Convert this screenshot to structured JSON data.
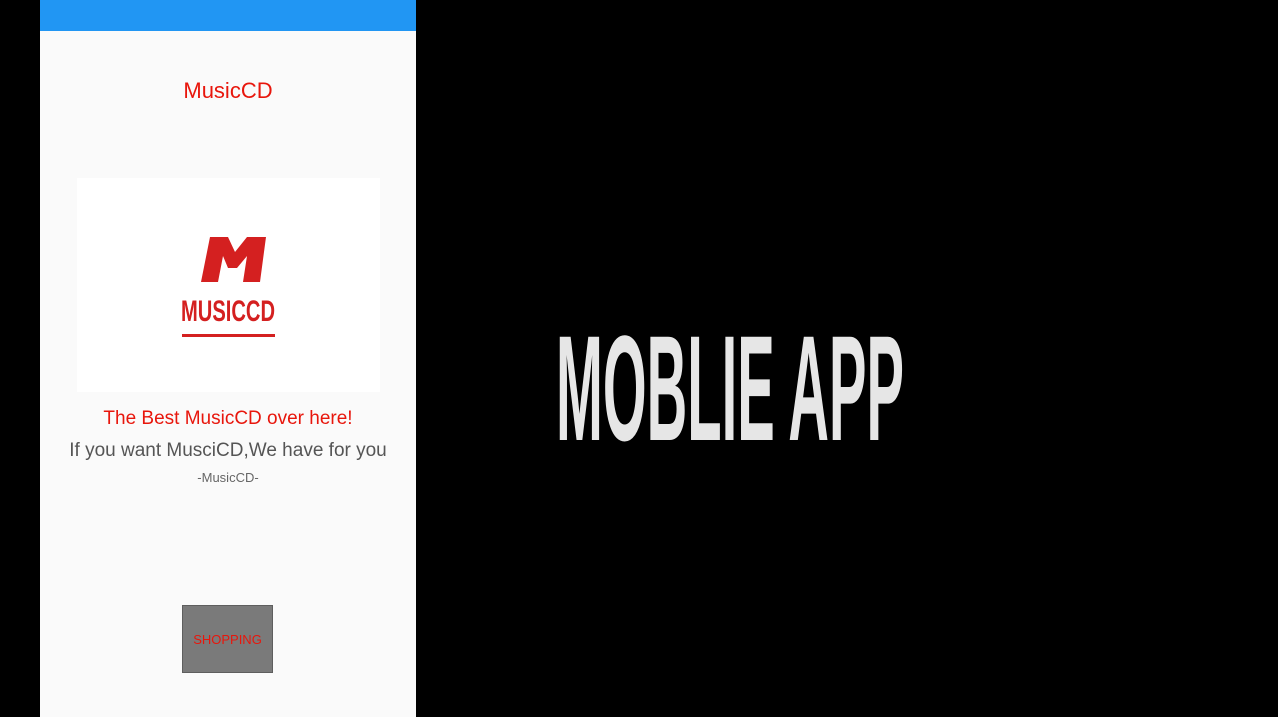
{
  "app": {
    "title": "MusicCD",
    "status_bar_color": "#2196f3",
    "accent_color": "#e8160c"
  },
  "logo": {
    "letter": "M",
    "wordmark": "MUSICCD",
    "color": "#d42020"
  },
  "content": {
    "headline": "The Best MusicCD over here!",
    "subline": "If you want MusciCD,We have for you",
    "signature": "-MusicCD-"
  },
  "shop_button": {
    "label": "SHOPPING",
    "background": "#7a7a7a"
  },
  "banner": {
    "text": "MOBLIE APP",
    "color": "#e6e6e6"
  }
}
